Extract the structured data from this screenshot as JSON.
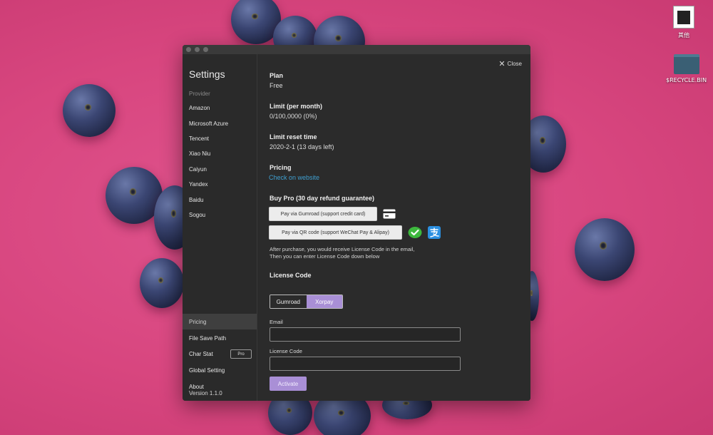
{
  "desktop": {
    "icons": [
      {
        "label": "其他"
      },
      {
        "label": "$RECYCLE.BIN"
      }
    ]
  },
  "window": {
    "sidebar": {
      "title": "Settings",
      "provider_section": "Provider",
      "providers": [
        "Amazon",
        "Microsoft Azure",
        "Tencent",
        "Xiao Niu",
        "Caiyun",
        "Yandex",
        "Baidu",
        "Sogou"
      ],
      "bottom_items": {
        "pricing": "Pricing",
        "file_save_path": "File Save Path",
        "char_stat": "Char Stat",
        "char_stat_badge": "Pro",
        "global_setting": "Global Setting",
        "about": "About"
      },
      "version": "Version 1.1.0"
    },
    "main": {
      "close_label": "Close",
      "plan_label": "Plan",
      "plan_value": "Free",
      "limit_label": "Limit (per month)",
      "limit_value": "0/100,0000 (0%)",
      "reset_label": "Limit reset time",
      "reset_value": "2020-2-1 (13 days left)",
      "pricing_label": "Pricing",
      "pricing_link": "Check on website",
      "buy_label": "Buy Pro (30 day refund guarantee)",
      "pay_gumroad": "Pay via Gumroad (support credit card)",
      "pay_qr": "Pay via QR code (support WeChat Pay & Alipay)",
      "note_line1": "After purchase, you would receive License Code in the email,",
      "note_line2": "Then you can enter License Code down below",
      "license_label": "License Code",
      "license_tabs": [
        "Gumroad",
        "Xorpay"
      ],
      "license_selected": "Xorpay",
      "email_label": "Email",
      "email_value": "",
      "code_label": "License Code",
      "code_value": "",
      "activate_label": "Activate"
    }
  },
  "colors": {
    "accent": "#a98fd6",
    "link": "#3f9fd0",
    "wechat": "#3db83d",
    "alipay": "#2b8fe0"
  }
}
